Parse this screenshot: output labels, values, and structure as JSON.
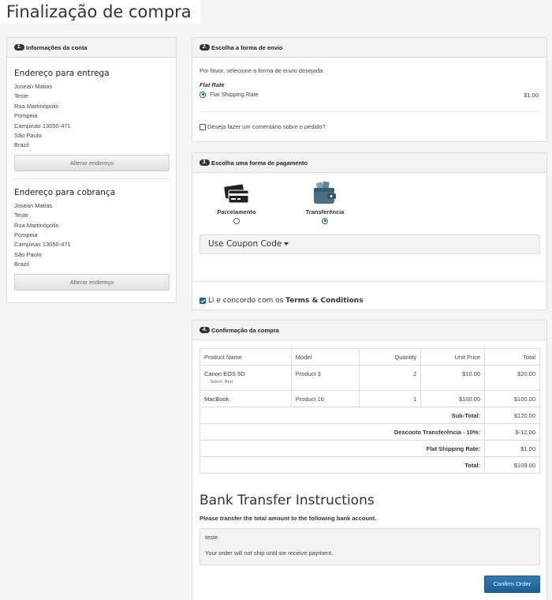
{
  "page_title": "Finalização de compra",
  "account": {
    "header_num": "1.",
    "header": "Informações da conta",
    "delivery_heading": "Endereço para entrega",
    "delivery_lines": [
      "Josean Matias",
      "Teste",
      "Rua Martinópolis",
      "Pompeia",
      "Campinas 13050-471",
      "São Paulo",
      "Brazil"
    ],
    "billing_heading": "Endereço para cobrança",
    "billing_lines": [
      "Josean Matias",
      "Teste",
      "Rua Martinópolis",
      "Pompeia",
      "Campinas 13050-471",
      "São Paulo",
      "Brazil"
    ],
    "change_address_label": "Alterar endereço"
  },
  "shipping": {
    "header_num": "2.",
    "header": "Escolha a forma de envio",
    "instruction": "Por favor, selecione a forma de envio desejada.",
    "method_group": "Flat Rate",
    "method_label": "Flat Shipping Rate",
    "method_price": "$1.00",
    "comment_label": "Deseja fazer um comentário sobre o pedido?"
  },
  "payment": {
    "header_num": "3.",
    "header": "Escolha uma forma de pagamento",
    "options": [
      {
        "label": "Parcelamento",
        "icon": "credit-cards-icon",
        "selected": false
      },
      {
        "label": "Transferência",
        "icon": "wallet-icon",
        "selected": true
      }
    ],
    "coupon_label": "Use Coupon Code",
    "terms_prefix": "Li e concordo com os ",
    "terms_link": "Terms & Conditions"
  },
  "confirm": {
    "header_num": "4.",
    "header": "Confirmação da compra",
    "columns": [
      "Product Name",
      "Model",
      "Quantity",
      "Unit Price",
      "Total"
    ],
    "rows": [
      {
        "name": "Canon EOS 5D",
        "option": "- Select: Red",
        "model": "Product 3",
        "qty": "2",
        "unit": "$10.00",
        "total": "$20.00"
      },
      {
        "name": "MacBook",
        "option": "",
        "model": "Product 16",
        "qty": "1",
        "unit": "$100.00",
        "total": "$100.00"
      }
    ],
    "totals": [
      {
        "label": "Sub-Total:",
        "value": "$120.00"
      },
      {
        "label": "Desconto Transferência - 10%:",
        "value": "$-12.00"
      },
      {
        "label": "Flat Shipping Rate:",
        "value": "$1.00"
      },
      {
        "label": "Total:",
        "value": "$109.00"
      }
    ],
    "bank_title": "Bank Transfer Instructions",
    "bank_subtitle": "Please transfer the total amount to the following bank account.",
    "bank_details": "teste",
    "bank_note": "Your order will not ship until we receive payment.",
    "confirm_button": "Confirm Order"
  },
  "colors": {
    "accent": "#1565c0",
    "button": "#2a6fa8"
  }
}
